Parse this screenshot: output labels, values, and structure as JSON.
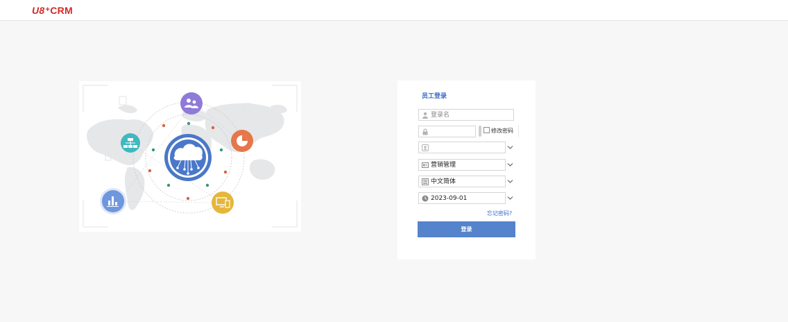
{
  "header": {
    "logo_u8": "U8",
    "logo_plus": "+",
    "logo_crm": "CRM"
  },
  "login": {
    "title": "员工登录",
    "username": {
      "placeholder": "登录名",
      "icon": "user-icon"
    },
    "password": {
      "value": "",
      "icon": "lock-icon"
    },
    "change_password_label": "修改密码",
    "account": {
      "value": "",
      "icon": "account-icon"
    },
    "system": {
      "value": "营销管理",
      "icon": "id-card-icon"
    },
    "language": {
      "value": "中文简体",
      "icon": "language-icon"
    },
    "date": {
      "value": "2023-09-01",
      "icon": "clock-icon"
    },
    "forgot_password": "忘记密码?",
    "submit": "登录"
  },
  "colors": {
    "brand_red": "#d12a27",
    "accent_blue": "#3a6bc5",
    "button_blue": "#5583cc",
    "bubble_purple": "#8f7ad9",
    "bubble_teal": "#3fb8bf",
    "bubble_orange": "#e5774a",
    "bubble_yellow": "#e5b63a",
    "bubble_blue": "#6f97dd",
    "hub_blue": "#4a78c9"
  }
}
